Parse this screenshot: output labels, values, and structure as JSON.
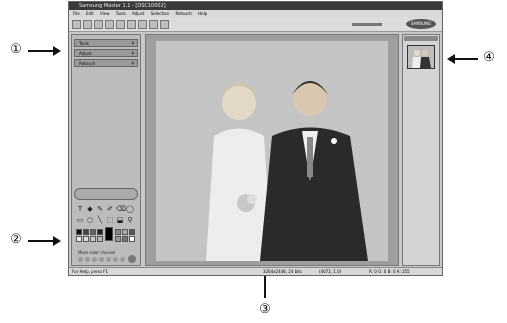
{
  "window": {
    "title": "Samsung Master 1.1 - [DSC10002]"
  },
  "menu": [
    "File",
    "Edit",
    "View",
    "Tools",
    "Adjust",
    "Selection",
    "Retouch",
    "Help"
  ],
  "left_panel": {
    "sections": [
      "Tools",
      "Adjust",
      "Retouch"
    ],
    "more_colors_label": "More color choices"
  },
  "brand": "SAMSUNG",
  "status": {
    "help": "For Help, press F1",
    "dims": "3264x2448, 24 bits",
    "coords": "(4072, 1.0)",
    "zoom": "R: 0 G: 0 B: 0 A: 255"
  },
  "callouts": {
    "c1": "①",
    "c2": "②",
    "c3": "③",
    "c4": "④"
  },
  "colors": {
    "accent": "#3a3a3a",
    "canvas": "#9e9e9e"
  }
}
